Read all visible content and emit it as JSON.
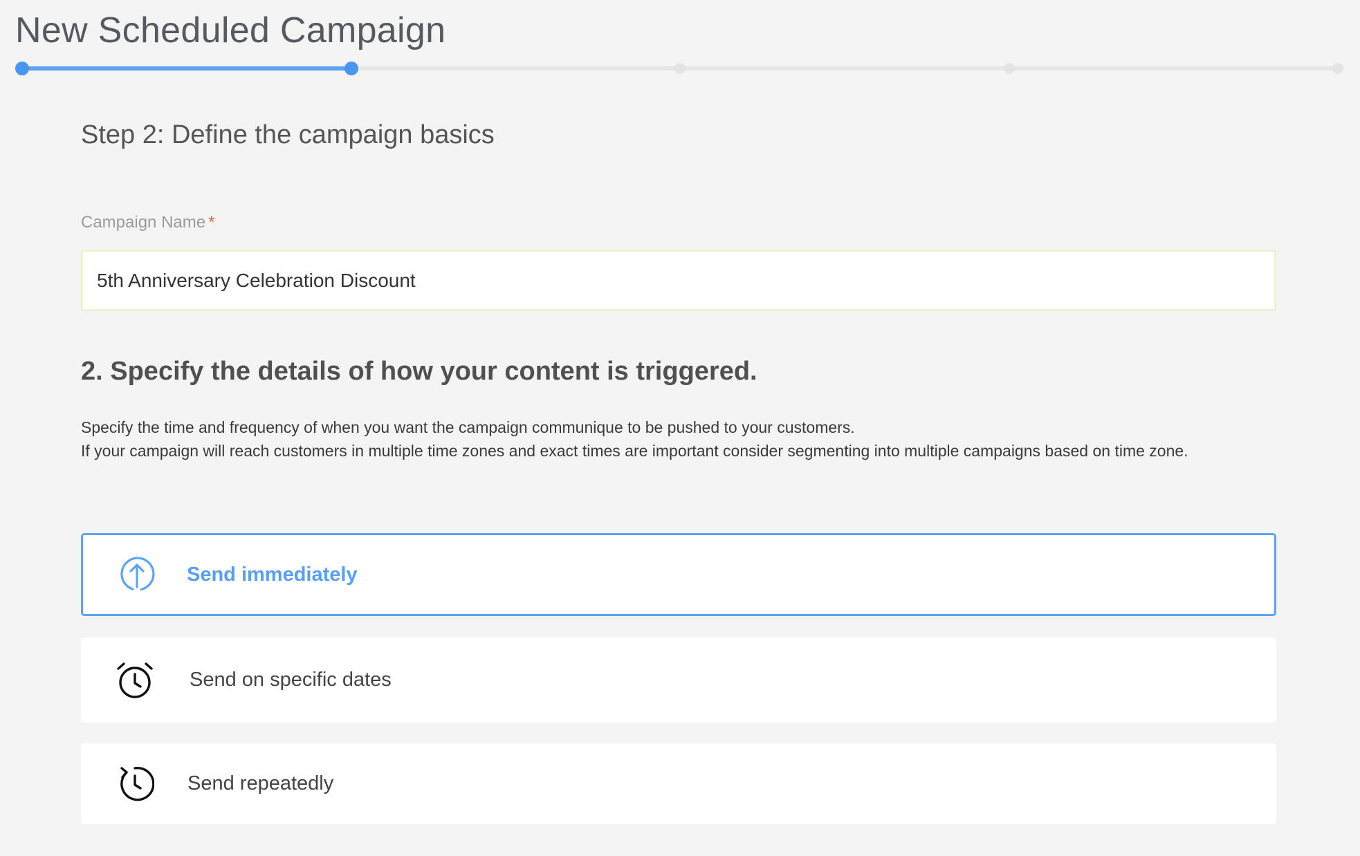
{
  "page": {
    "title": "New Scheduled Campaign"
  },
  "stepper": {
    "total_steps": 5,
    "current_step": 2
  },
  "step": {
    "heading": "Step 2: Define the campaign basics"
  },
  "campaign_name": {
    "label": "Campaign Name",
    "required_marker": "*",
    "value": "5th Anniversary Celebration Discount"
  },
  "trigger": {
    "heading": "2. Specify the details of how your content is triggered.",
    "description_line1": "Specify the time and frequency of when you want the campaign communique to be pushed to your customers.",
    "description_line2": "If your campaign will reach customers in multiple time zones and exact times are important consider segmenting into multiple campaigns based on time zone.",
    "options": [
      {
        "label": "Send immediately",
        "icon": "send-up-arrow-icon",
        "selected": true
      },
      {
        "label": "Send on specific dates",
        "icon": "alarm-clock-icon",
        "selected": false
      },
      {
        "label": "Send repeatedly",
        "icon": "repeat-clock-icon",
        "selected": false
      }
    ]
  },
  "colors": {
    "accent": "#5da3f2",
    "required": "#e8592f",
    "background": "#f4f4f4"
  }
}
